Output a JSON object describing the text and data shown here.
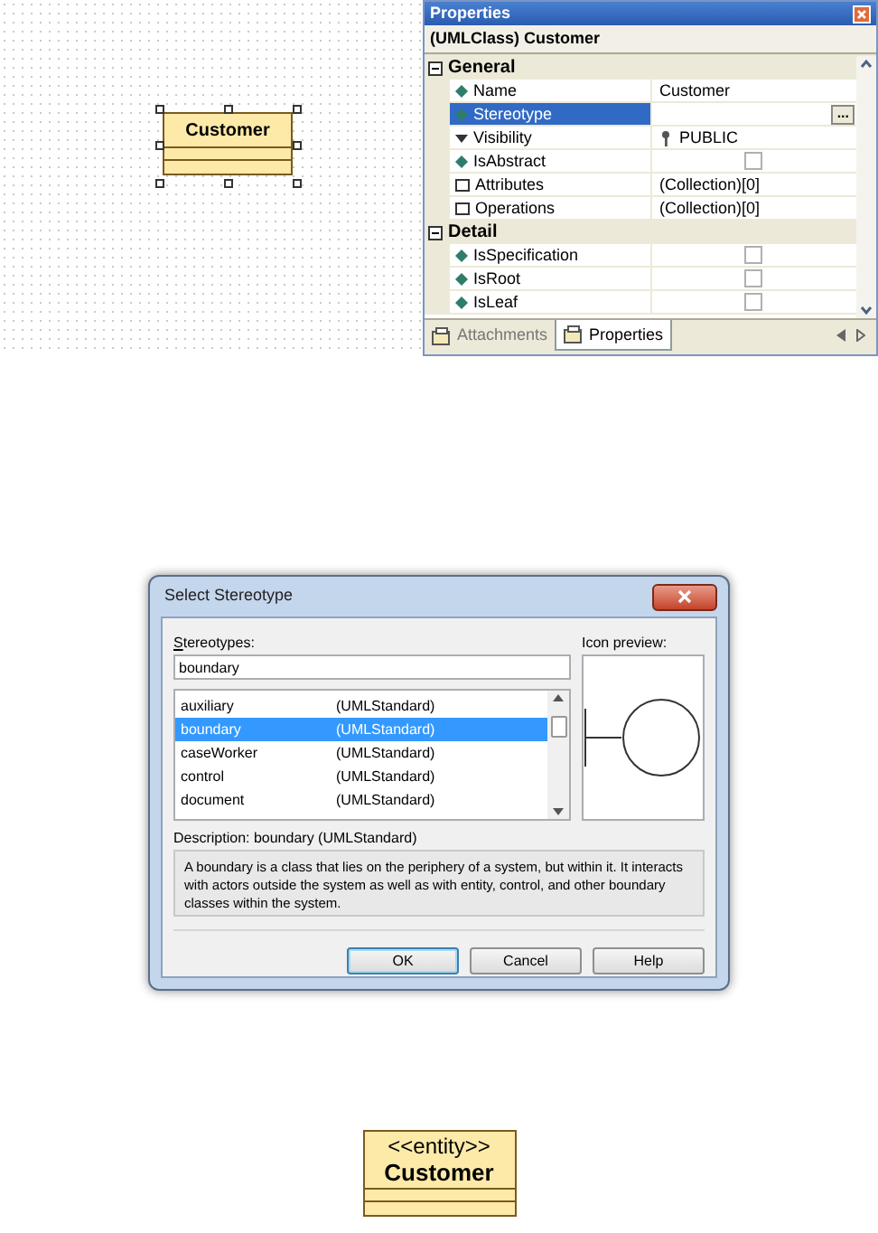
{
  "canvas": {
    "class_box": {
      "name": "Customer",
      "selected": true
    }
  },
  "properties": {
    "title": "Properties",
    "header": "(UMLClass) Customer",
    "categories": [
      {
        "label": "General",
        "expanded": true,
        "rows": [
          {
            "kind": "text",
            "name": "Name",
            "value": "Customer",
            "selected": false
          },
          {
            "kind": "button",
            "name": "Stereotype",
            "button_label": "...",
            "selected": true
          },
          {
            "kind": "visibility",
            "name": "Visibility",
            "value": "PUBLIC",
            "selected": false
          },
          {
            "kind": "checkbox",
            "name": "IsAbstract",
            "checked": false,
            "selected": false
          },
          {
            "kind": "collection",
            "name": "Attributes",
            "value": "(Collection)[0]",
            "selected": false
          },
          {
            "kind": "collection",
            "name": "Operations",
            "value": "(Collection)[0]",
            "selected": false
          }
        ]
      },
      {
        "label": "Detail",
        "expanded": true,
        "rows": [
          {
            "kind": "checkbox",
            "name": "IsSpecification",
            "checked": false,
            "selected": false
          },
          {
            "kind": "checkbox",
            "name": "IsRoot",
            "checked": false,
            "selected": false
          },
          {
            "kind": "checkbox",
            "name": "IsLeaf",
            "checked": false,
            "selected": false
          }
        ]
      }
    ],
    "tabs": [
      {
        "label": "Attachments",
        "selected": false
      },
      {
        "label": "Properties",
        "selected": true
      }
    ]
  },
  "dialog": {
    "title": "Select Stereotype",
    "stereotypes_label": "Stereotypes:",
    "stereotype_value": "boundary",
    "preview_label": "Icon preview:",
    "items": [
      {
        "name": "auxiliary",
        "source": "(UMLStandard)",
        "selected": false
      },
      {
        "name": "boundary",
        "source": "(UMLStandard)",
        "selected": true
      },
      {
        "name": "caseWorker",
        "source": "(UMLStandard)",
        "selected": false
      },
      {
        "name": "control",
        "source": "(UMLStandard)",
        "selected": false
      },
      {
        "name": "document",
        "source": "(UMLStandard)",
        "selected": false
      }
    ],
    "description_label": "Description: boundary (UMLStandard)",
    "description": "A boundary is a class that lies on the periphery of a system, but within it. It interacts with actors outside the system as well as with entity, control, and other boundary classes within the system.",
    "buttons": [
      {
        "label": "OK",
        "default": true
      },
      {
        "label": "Cancel",
        "default": false
      },
      {
        "label": "Help",
        "default": false
      }
    ]
  },
  "result_class": {
    "stereotype": "<<entity>>",
    "name": "Customer"
  }
}
